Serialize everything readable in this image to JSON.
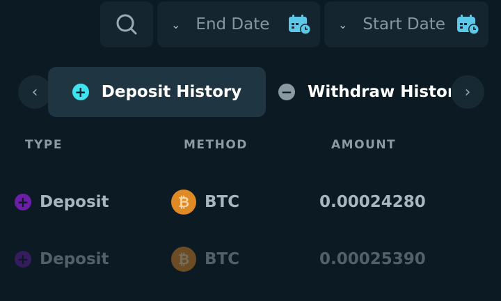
{
  "filters": {
    "search_icon": "search-icon",
    "end_date": {
      "label": "End Date",
      "icon": "calendar-icon"
    },
    "start_date": {
      "label": "Start Date",
      "icon": "calendar-icon"
    }
  },
  "tabs": [
    {
      "label": "Deposit History",
      "icon": "plus-circle-icon",
      "active": true
    },
    {
      "label": "Withdraw History",
      "icon": "minus-circle-icon",
      "active": false
    }
  ],
  "table": {
    "columns": [
      "TYPE",
      "METHOD",
      "AMOUNT"
    ],
    "rows": [
      {
        "type": "Deposit",
        "method": "BTC",
        "amount": "0.00024280"
      },
      {
        "type": "Deposit",
        "method": "BTC",
        "amount": "0.00025390"
      }
    ]
  },
  "colors": {
    "background": "#0b1a23",
    "accent": "#3fe3f0",
    "deposit_icon": "#6b1fa6",
    "btc": "#e08a26"
  }
}
